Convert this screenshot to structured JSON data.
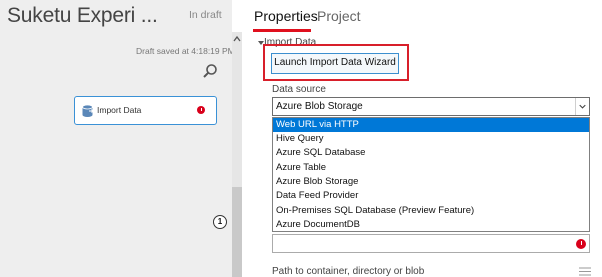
{
  "left_pane": {
    "experiment_title": "Suketu Experi  ...",
    "draft_status": "In draft",
    "saved_text": "Draft saved at 4:18:19 PM",
    "module": {
      "label": "Import Data",
      "port_number": "1"
    }
  },
  "tabs": [
    {
      "label": "Properties",
      "active": true
    },
    {
      "label": "Project",
      "active": false
    }
  ],
  "section": {
    "title": "Import Data"
  },
  "launch_button": {
    "label": "Launch Import Data Wizard"
  },
  "datasource": {
    "label": "Data source",
    "selected_value": "Azure Blob Storage",
    "options": [
      "Web URL via HTTP",
      "Hive Query",
      "Azure SQL Database",
      "Azure Table",
      "Azure Blob Storage",
      "Data Feed Provider",
      "On-Premises SQL Database (Preview Feature)",
      "Azure DocumentDB"
    ],
    "highlighted_option": "Web URL via HTTP"
  },
  "path_field": {
    "label": "Path to container, directory or blob"
  },
  "colors": {
    "accent_red": "#e0101e",
    "highlight_border": "#d81f2a",
    "selection_blue": "#0078d7",
    "module_border": "#3a91d6",
    "error_red": "#d9001b"
  }
}
